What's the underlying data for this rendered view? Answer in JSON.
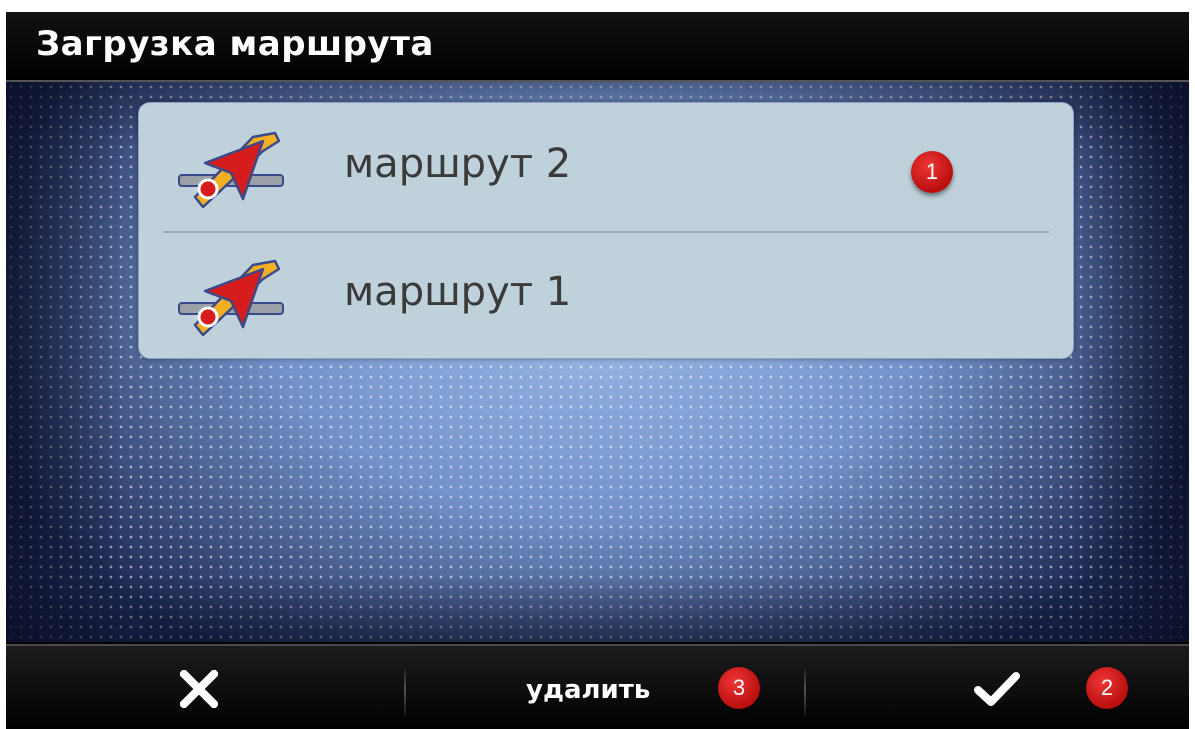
{
  "header": {
    "title": "Загрузка маршрута"
  },
  "routes": [
    {
      "label": "маршрут 2",
      "icon": "route-icon"
    },
    {
      "label": "маршрут 1",
      "icon": "route-icon"
    }
  ],
  "annotations": {
    "badge_list": "1",
    "badge_confirm": "2",
    "badge_delete": "3"
  },
  "toolbar": {
    "close_icon": "close-icon",
    "delete_label": "удалить",
    "confirm_icon": "check-icon"
  },
  "colors": {
    "badge": "#d11a1a",
    "list_bg": "#bfd2db",
    "background": "#6f8fc8"
  }
}
